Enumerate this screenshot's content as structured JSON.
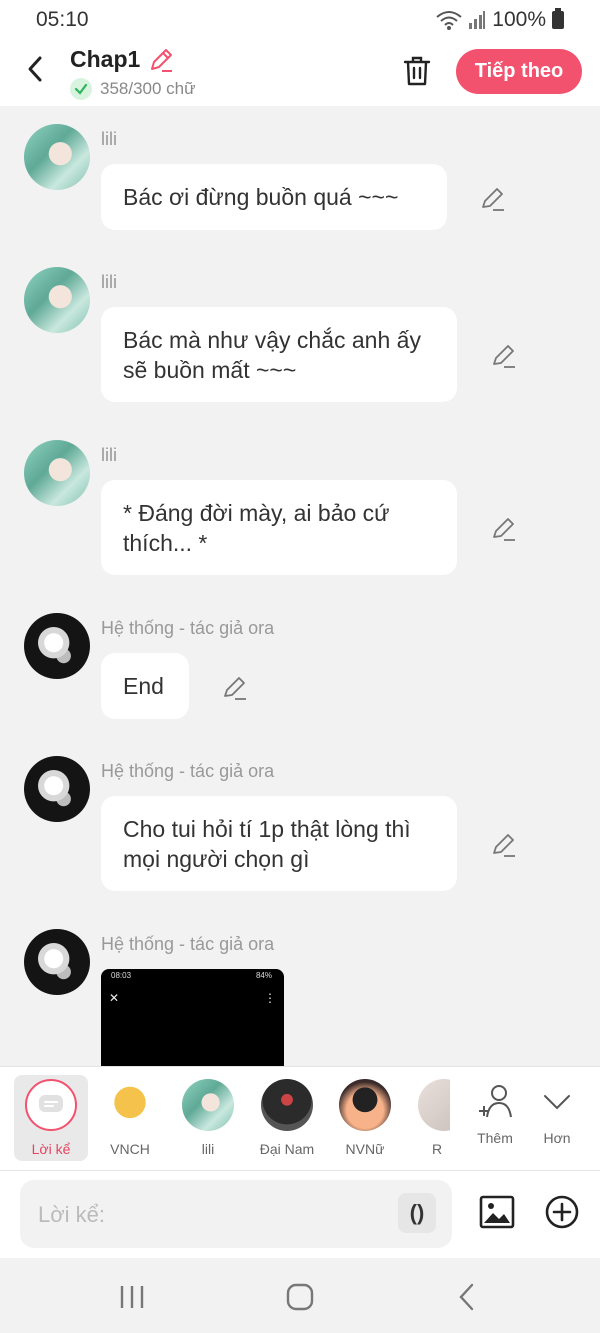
{
  "status_bar": {
    "time": "05:10",
    "battery": "100%"
  },
  "header": {
    "title": "Chap1",
    "word_count": "358/300 chữ",
    "next_button": "Tiếp theo",
    "accent_color": "#f2526e"
  },
  "messages": [
    {
      "sender": "lili",
      "text": "Bác ơi đừng buồn quá ~~~"
    },
    {
      "sender": "lili",
      "text": "Bác mà như vậy chắc anh ấy sẽ buồn mất ~~~"
    },
    {
      "sender": "lili",
      "text": "* Đáng đời mày, ai bảo cứ thích... *"
    },
    {
      "sender": "Hệ thống - tác giả ora",
      "text": "End"
    },
    {
      "sender": "Hệ thống - tác giả ora",
      "text": "Cho tui hỏi tí 1p thật lòng thì mọi người chọn gì"
    },
    {
      "sender": "Hệ thống - tác giả ora",
      "image_status_time": "08:03",
      "image_status_battery": "84%"
    }
  ],
  "characters": [
    {
      "label": "Lời kể",
      "selected": true
    },
    {
      "label": "VNCH"
    },
    {
      "label": "lili"
    },
    {
      "label": "Đại Nam"
    },
    {
      "label": "NVNữ"
    },
    {
      "label": "R"
    }
  ],
  "more_button": "Thêm",
  "expand_button": "Hơn",
  "input": {
    "placeholder": "Lời kể:",
    "paren_button": "()"
  }
}
